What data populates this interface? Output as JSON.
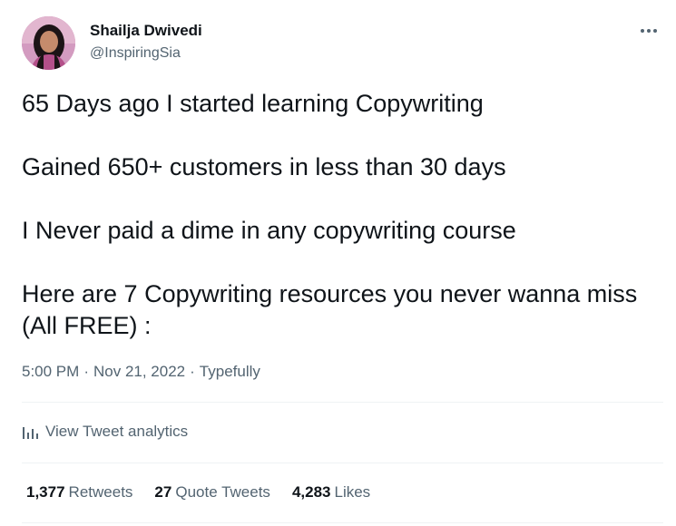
{
  "author": {
    "name": "Shailja Dwivedi",
    "handle": "@InspiringSia"
  },
  "tweet": {
    "lines": [
      "65 Days ago I started learning Copywriting",
      "Gained 650+ customers in less than 30 days",
      "I Never paid a dime in any copywriting course",
      "Here are 7 Copywriting resources you never wanna miss (All FREE) :"
    ],
    "time": "5:00 PM",
    "separator": "·",
    "date": "Nov 21, 2022",
    "source": "Typefully"
  },
  "analytics": {
    "label": "View Tweet analytics",
    "icon": "bar-chart-icon"
  },
  "stats": {
    "retweets_count": "1,377",
    "retweets_label": "Retweets",
    "quotes_count": "27",
    "quotes_label": "Quote Tweets",
    "likes_count": "4,283",
    "likes_label": "Likes"
  },
  "colors": {
    "text": "#0f1419",
    "secondary": "#536471",
    "divider": "#eff3f4"
  }
}
